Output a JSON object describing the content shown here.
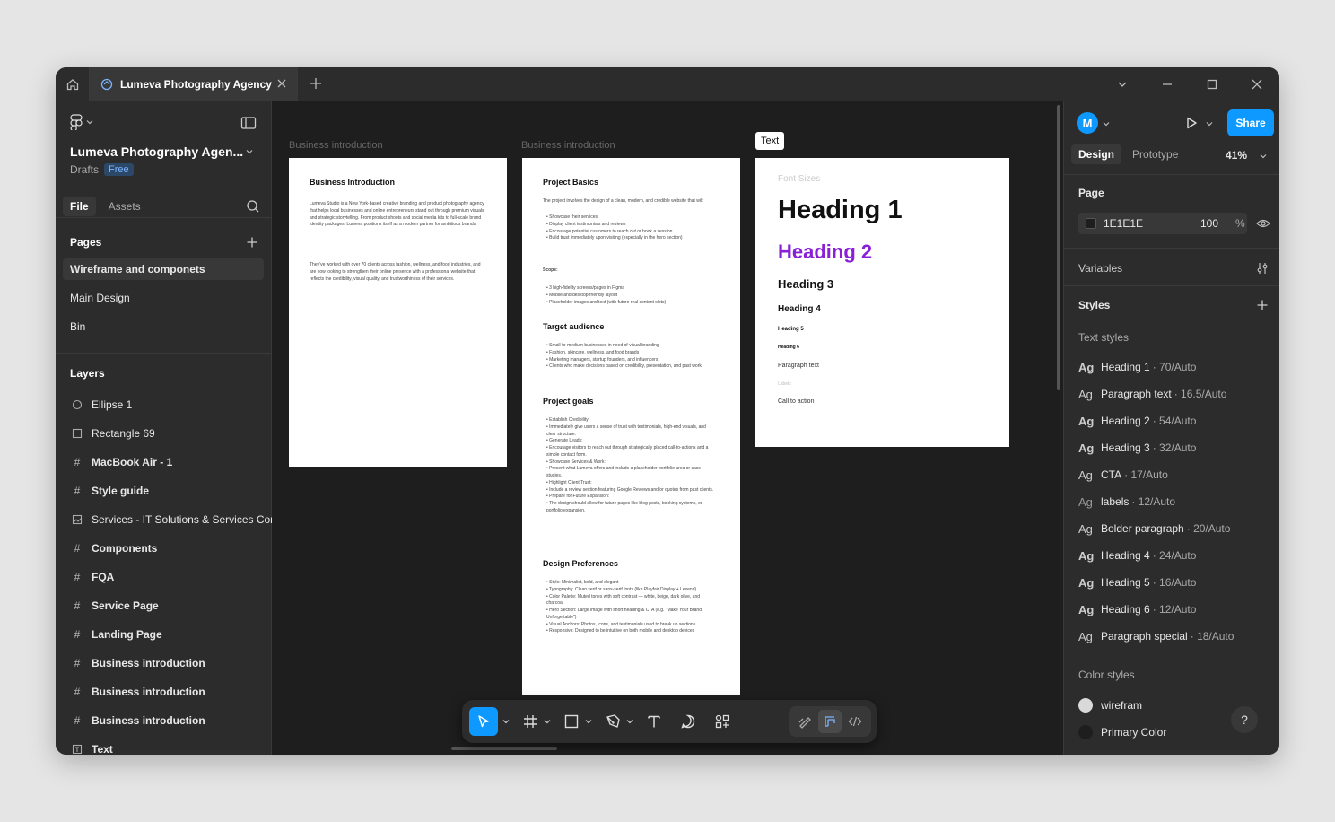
{
  "titlebar": {
    "tab_title": "Lumeva Photography Agency"
  },
  "left_panel": {
    "file_name": "Lumeva Photography Agen...",
    "drafts_label": "Drafts",
    "plan_badge": "Free",
    "tabs": [
      "File",
      "Assets"
    ],
    "pages_heading": "Pages",
    "pages": [
      "Wireframe and componets",
      "Main Design",
      "Bin"
    ],
    "layers_heading": "Layers",
    "layers": [
      {
        "label": "Ellipse 1",
        "icon": "ellipse-icon"
      },
      {
        "label": "Rectangle 69",
        "icon": "rectangle-icon"
      },
      {
        "label": "MacBook Air - 1",
        "icon": "frame-icon"
      },
      {
        "label": "Style guide",
        "icon": "frame-icon"
      },
      {
        "label": "Services - IT Solutions & Services Cor",
        "icon": "image-icon"
      },
      {
        "label": "Components",
        "icon": "frame-icon"
      },
      {
        "label": "FQA",
        "icon": "frame-icon"
      },
      {
        "label": "Service Page",
        "icon": "frame-icon"
      },
      {
        "label": "Landing Page",
        "icon": "frame-icon"
      },
      {
        "label": "Business introduction",
        "icon": "frame-icon"
      },
      {
        "label": "Business introduction",
        "icon": "frame-icon"
      },
      {
        "label": "Business introduction",
        "icon": "frame-icon"
      },
      {
        "label": "Text",
        "icon": "text-frame-icon"
      }
    ]
  },
  "canvas": {
    "frame1": {
      "label": "Business introduction",
      "heading": "Business Introduction",
      "p1": "Lumeva Studio is a New York-based creative branding and product photography agency that helps local businesses and online entrepreneurs stand out through premium visuals and strategic storytelling. From product shoots and social media kits to full-scale brand identity packages, Lumeva positions itself as a modern partner for ambitious brands.",
      "p2": "They've worked with over 70 clients across fashion, wellness, and food industries, and are now looking to strengthen their online presence with a professional website that reflects the credibility, visual quality, and trustworthiness of their services."
    },
    "frame2": {
      "label": "Business introduction",
      "project_basics": "Project Basics",
      "basics_intro": "The project involves the design of a clean, modern, and credible website that will:",
      "basics_items": [
        "Showcase their services",
        "Display client testimonials and reviews",
        "Encourage potential customers to reach out or book a session",
        "Build trust immediately upon visiting (especially in the hero section)"
      ],
      "scope_label": "Scope:",
      "scope_items": [
        "3 high-fidelity screens/pages in Figma",
        "Mobile and desktop-friendly layout",
        "Placeholder images and text (with future real content slots)"
      ],
      "target_heading": "Target audience",
      "target_items": [
        "Small-to-medium businesses in need of visual branding",
        "Fashion, skincare, wellness, and food brands",
        "Marketing managers, startup founders, and influencers",
        "Clients who make decisions based on credibility, presentation, and past work"
      ],
      "goals_heading": "Project goals",
      "goals_items": [
        "Establish Credibility:",
        "Immediately give users a sense of trust with testimonials, high-end visuals, and clear structure.",
        "Generate Leads:",
        "Encourage visitors to reach out through strategically placed call-to-actions and a simple contact form.",
        "Showcase Services & Work:",
        "Present what Lumeva offers and include a placeholder portfolio area or case studies.",
        "Highlight Client Trust:",
        "Include a review section featuring Google Reviews and/or quotes from past clients.",
        "Prepare for Future Expansion:",
        "The design should allow for future pages like blog posts, booking systems, or portfolio expansion."
      ],
      "prefs_heading": "Design Preferences",
      "prefs_items": [
        "Style: Minimalist, bold, and elegant",
        "Typography: Clean serif or sans-serif fonts (like Playfair Display + Lexend)",
        "Color Palette: Muted tones with soft contrast — white, beige, dark olive, and charcoal",
        "Hero Section: Large image with short heading & CTA (e.g. \"Make Your Brand Unforgettable\")",
        "Visual Anchors: Photos, icons, and testimonials used to break up sections",
        "Responsive: Designed to be intuitive on both mobile and desktop devices"
      ]
    },
    "frame3": {
      "tag": "Text",
      "font_sizes": "Font Sizes",
      "h1": "Heading 1",
      "h2": "Heading 2",
      "h3": "Heading 3",
      "h4": "Heading 4",
      "h5": "Heading 5",
      "h6": "Heading 6",
      "paragraph": "Paragraph text",
      "labels": "Labels",
      "cta": "Call to action",
      "h2_color": "#8a1fd8"
    }
  },
  "right_panel": {
    "avatar_letter": "M",
    "share_label": "Share",
    "tabs": [
      "Design",
      "Prototype"
    ],
    "zoom": "41%",
    "page_heading": "Page",
    "page_color_hex": "1E1E1E",
    "page_opacity": "100",
    "percent": "%",
    "variables_heading": "Variables",
    "styles_heading": "Styles",
    "text_styles_heading": "Text styles",
    "text_styles": [
      {
        "name": "Heading 1",
        "meta": "· 70/Auto",
        "weight": "bold"
      },
      {
        "name": "Paragraph text",
        "meta": "· 16.5/Auto",
        "weight": "semibold"
      },
      {
        "name": "Heading 2",
        "meta": "· 54/Auto",
        "weight": "bold"
      },
      {
        "name": "Heading 3",
        "meta": "· 32/Auto",
        "weight": "bold"
      },
      {
        "name": "CTA",
        "meta": "· 17/Auto",
        "weight": "regular"
      },
      {
        "name": "labels",
        "meta": "· 12/Auto",
        "weight": "light"
      },
      {
        "name": "Bolder paragraph",
        "meta": "· 20/Auto",
        "weight": "semibold"
      },
      {
        "name": "Heading 4",
        "meta": "· 24/Auto",
        "weight": "bold"
      },
      {
        "name": "Heading 5",
        "meta": "· 16/Auto",
        "weight": "bold"
      },
      {
        "name": "Heading 6",
        "meta": "· 12/Auto",
        "weight": "bold"
      },
      {
        "name": "Paragraph special",
        "meta": "· 18/Auto",
        "weight": "regular"
      }
    ],
    "color_styles_heading": "Color styles",
    "color_styles": [
      {
        "name": "wirefram",
        "color": "#d9d9d9"
      },
      {
        "name": "Primary Color",
        "color": "#1e1e1e"
      }
    ],
    "help_label": "?"
  },
  "colors": {
    "accent": "#0d99ff",
    "window_bg": "#2c2c2c",
    "canvas_bg": "#1e1e1e"
  }
}
